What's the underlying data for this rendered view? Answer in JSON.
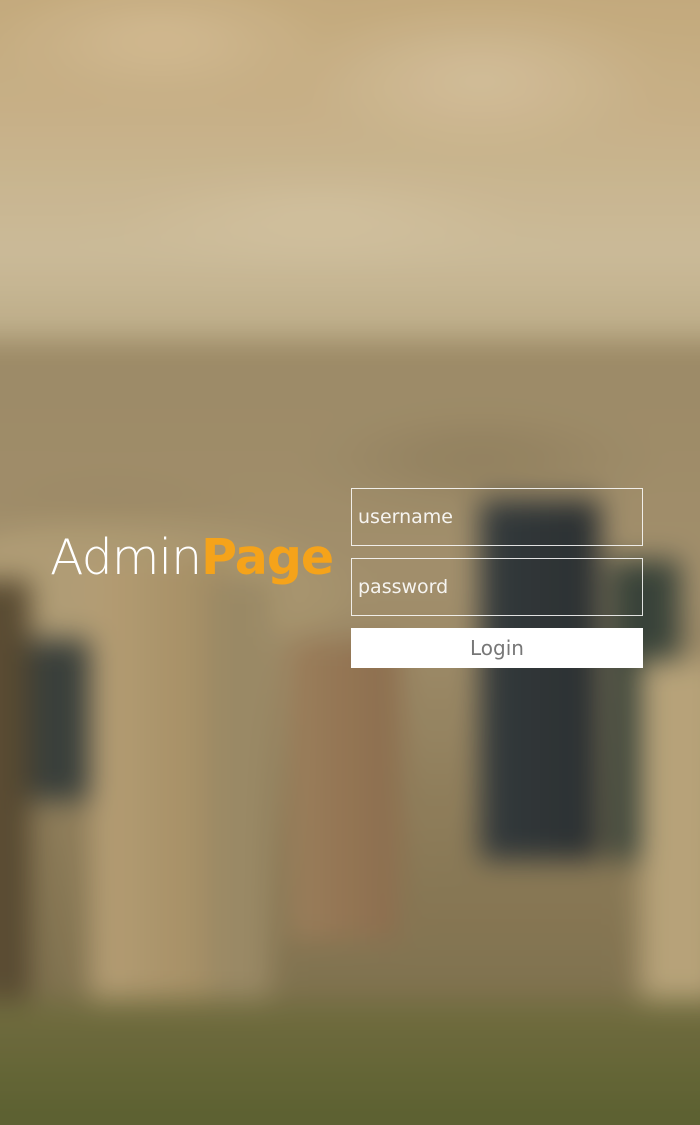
{
  "brand": {
    "part1": "Admin",
    "part2": "Page",
    "accent_color": "#f5a31a"
  },
  "login_form": {
    "username_placeholder": "username",
    "password_placeholder": "password",
    "submit_label": "Login"
  },
  "background": {
    "description_icon": "blurred-city-skyline-image"
  }
}
